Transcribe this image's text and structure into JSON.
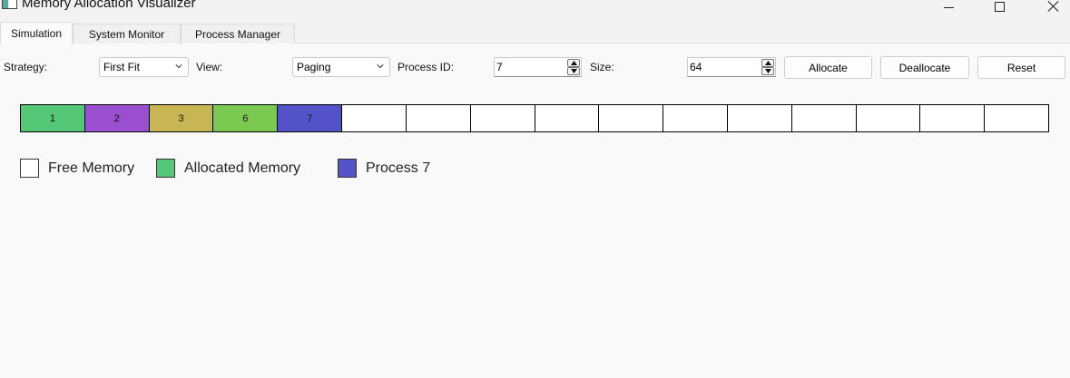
{
  "window": {
    "title": "Memory Allocation Visualizer"
  },
  "tabs": [
    {
      "label": "Simulation"
    },
    {
      "label": "System Monitor"
    },
    {
      "label": "Process Manager"
    }
  ],
  "controls": {
    "strategy_label": "Strategy:",
    "strategy_value": "First Fit",
    "view_label": "View:",
    "view_value": "Paging",
    "process_id_label": "Process ID:",
    "process_id_value": "7",
    "size_label": "Size:",
    "size_value": "64",
    "allocate_label": "Allocate",
    "deallocate_label": "Deallocate",
    "reset_label": "Reset"
  },
  "memory_blocks": [
    {
      "label": "1",
      "color": "#55c878"
    },
    {
      "label": "2",
      "color": "#9a4fd0"
    },
    {
      "label": "3",
      "color": "#c8b553"
    },
    {
      "label": "6",
      "color": "#7bc951"
    },
    {
      "label": "7",
      "color": "#5352c9"
    },
    {
      "label": "",
      "color": "#ffffff"
    },
    {
      "label": "",
      "color": "#ffffff"
    },
    {
      "label": "",
      "color": "#ffffff"
    },
    {
      "label": "",
      "color": "#ffffff"
    },
    {
      "label": "",
      "color": "#ffffff"
    },
    {
      "label": "",
      "color": "#ffffff"
    },
    {
      "label": "",
      "color": "#ffffff"
    },
    {
      "label": "",
      "color": "#ffffff"
    },
    {
      "label": "",
      "color": "#ffffff"
    },
    {
      "label": "",
      "color": "#ffffff"
    },
    {
      "label": "",
      "color": "#ffffff"
    }
  ],
  "legend": [
    {
      "label": "Free Memory",
      "color": "#ffffff"
    },
    {
      "label": "Allocated Memory",
      "color": "#55c878"
    },
    {
      "label": "Process 7",
      "color": "#5352c9"
    }
  ]
}
